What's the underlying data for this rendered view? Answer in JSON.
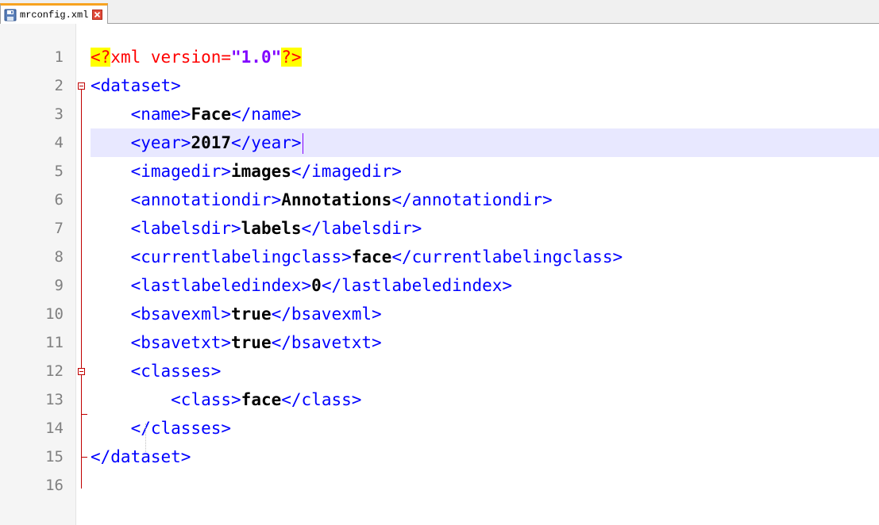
{
  "tab": {
    "label": "mrconfig.xml",
    "icon": "save-icon",
    "close_icon": "close-icon"
  },
  "colors": {
    "tag": "#0000ff",
    "value": "#000000",
    "declaration_highlight": "#ffff00",
    "attribute": "#ff0000",
    "attribute_value": "#8000ff",
    "current_line": "#e8e8ff",
    "fold": "#c00000",
    "tab_accent": "#f7a320"
  },
  "line_numbers": [
    "1",
    "2",
    "3",
    "4",
    "5",
    "6",
    "7",
    "8",
    "9",
    "10",
    "11",
    "12",
    "13",
    "14",
    "15",
    "16"
  ],
  "lines": [
    {
      "open": "<?",
      "attr": "xml version=",
      "str": "\"1.0\"",
      "close": "?>"
    },
    {
      "tag": "<dataset>"
    },
    {
      "indent": "    ",
      "open_tag": "<name>",
      "value": "Face",
      "close_tag": "</name>"
    },
    {
      "indent": "    ",
      "open_tag": "<year>",
      "value": "2017",
      "close_tag": "</year>"
    },
    {
      "indent": "    ",
      "open_tag": "<imagedir>",
      "value": "images",
      "close_tag": "</imagedir>"
    },
    {
      "indent": "    ",
      "open_tag": "<annotationdir>",
      "value": "Annotations",
      "close_tag": "</annotationdir>"
    },
    {
      "indent": "    ",
      "open_tag": "<labelsdir>",
      "value": "labels",
      "close_tag": "</labelsdir>"
    },
    {
      "indent": "    ",
      "open_tag": "<currentlabelingclass>",
      "value": "face",
      "close_tag": "</currentlabelingclass>"
    },
    {
      "indent": "    ",
      "open_tag": "<lastlabeledindex>",
      "value": "0",
      "close_tag": "</lastlabeledindex>"
    },
    {
      "indent": "    ",
      "open_tag": "<bsavexml>",
      "value": "true",
      "close_tag": "</bsavexml>"
    },
    {
      "indent": "    ",
      "open_tag": "<bsavetxt>",
      "value": "true",
      "close_tag": "</bsavetxt>"
    },
    {
      "indent": "    ",
      "tag": "<classes>"
    },
    {
      "indent": "        ",
      "open_tag": "<class>",
      "value": "face",
      "close_tag": "</class>"
    },
    {
      "indent": "    ",
      "tag": "</classes>"
    },
    {
      "tag": "</dataset>"
    },
    {}
  ]
}
